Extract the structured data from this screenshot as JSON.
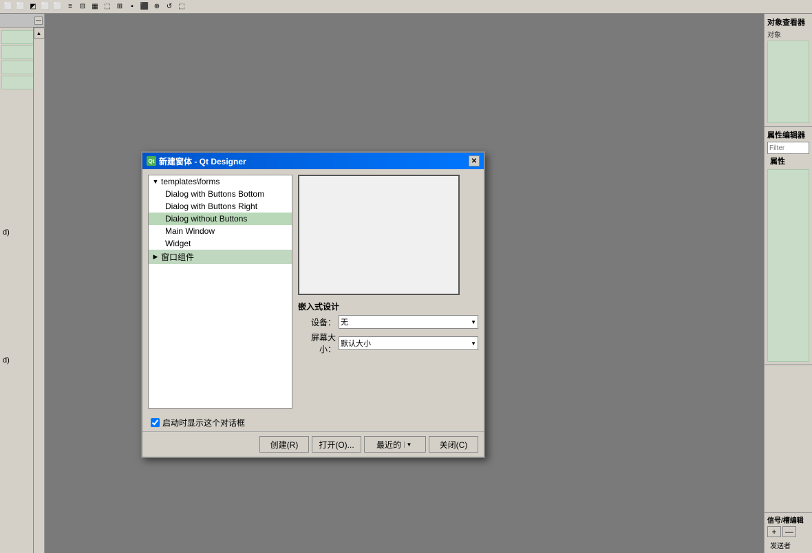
{
  "toolbar": {
    "icons": [
      "⬜",
      "⬜",
      "⬜",
      "⬜",
      "⬜",
      "⬜",
      "⬜",
      "⬜",
      "⬜",
      "⬜",
      "⬜",
      "⬜",
      "⬜",
      "⬜",
      "⬜",
      "⬜",
      "⬜",
      "⬜"
    ]
  },
  "left_panel": {
    "min_btn": "—",
    "items": [
      {
        "label": "d)"
      },
      {
        "label": ""
      },
      {
        "label": ""
      },
      {
        "label": ""
      },
      {
        "label": "d)"
      }
    ]
  },
  "right_panel": {
    "object_inspector_title": "对象查看器",
    "object_label": "对象",
    "property_editor_title": "属性编辑器",
    "filter_placeholder": "Filter",
    "property_label": "属性",
    "signal_title": "信号/槽编辑",
    "add_btn": "+",
    "remove_btn": "—",
    "sender_label": "发送者"
  },
  "dialog": {
    "title": "新建窗体 - Qt Designer",
    "qt_icon": "Qt",
    "close_btn": "✕",
    "tree": {
      "root": {
        "label": "templates\\forms",
        "expanded": true,
        "children": [
          {
            "label": "Dialog with Buttons Bottom",
            "selected": false
          },
          {
            "label": "Dialog with Buttons Right",
            "selected": false
          },
          {
            "label": "Dialog without Buttons",
            "selected": true
          },
          {
            "label": "Main Window",
            "selected": false
          },
          {
            "label": "Widget",
            "selected": false
          }
        ]
      },
      "second_root": {
        "label": "窗口组件",
        "expanded": false
      }
    },
    "embedded_label": "嵌入式设计",
    "device_label": "设备：",
    "device_value": "无",
    "screen_label": "屏幕大小：",
    "screen_value": "默认大小",
    "checkbox_label": "启动时显示这个对话框",
    "checkbox_checked": true,
    "btn_create": "创建(R)",
    "btn_open": "打开(O)...",
    "btn_recent": "最近的 ▼",
    "btn_close": "关闭(C)"
  }
}
